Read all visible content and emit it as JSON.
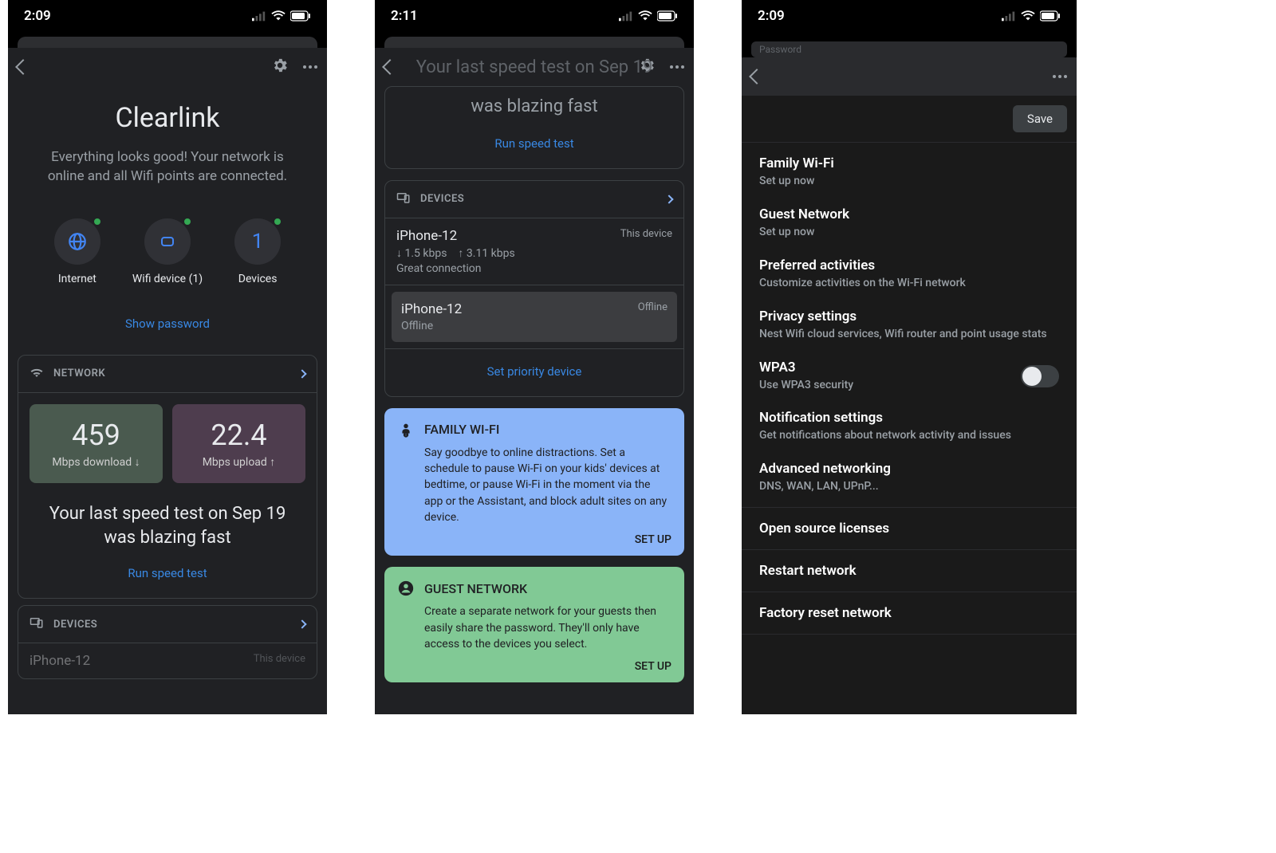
{
  "screen1": {
    "status": {
      "time": "2:09"
    },
    "title": "Clearlink",
    "subtitle": "Everything looks good! Your network is online and all Wifi points are connected.",
    "chips": {
      "internet": "Internet",
      "wifi": "Wifi device (1)",
      "devices_label": "Devices",
      "devices_count": "1"
    },
    "show_password": "Show password",
    "network_header": "NETWORK",
    "download_value": "459",
    "download_label": "Mbps download ↓",
    "upload_value": "22.4",
    "upload_label": "Mbps upload ↑",
    "speed_msg": "Your last speed test on Sep 19 was blazing fast",
    "run_speed_test": "Run speed test",
    "devices_header": "DEVICES",
    "device_peek_name": "iPhone-12",
    "device_peek_tag": "This device"
  },
  "screen2": {
    "status": {
      "time": "2:11"
    },
    "ghost_title": "Your last speed test on Sep 19",
    "speed_msg_tail": "was blazing fast",
    "run_speed_test": "Run speed test",
    "devices_header": "DEVICES",
    "dev1": {
      "name": "iPhone-12",
      "tag": "This device",
      "down": "↓ 1.5 kbps",
      "up": "↑ 3.11 kbps",
      "conn": "Great connection"
    },
    "dev2": {
      "name": "iPhone-12",
      "status": "Offline",
      "tag": "Offline"
    },
    "set_priority": "Set priority device",
    "family": {
      "title": "FAMILY WI-FI",
      "body": "Say goodbye to online distractions. Set a schedule to pause Wi-Fi on your kids' devices at bedtime, or pause Wi-Fi in the moment via the app or the Assistant, and block adult sites on any device.",
      "action": "SET UP"
    },
    "guest": {
      "title": "GUEST NETWORK",
      "body": "Create a separate network for your guests then easily share the password. They'll only have access to the devices you select.",
      "action": "SET UP"
    }
  },
  "screen3": {
    "status": {
      "time": "2:09"
    },
    "pwd_label": "Password",
    "save": "Save",
    "items": [
      {
        "title": "Family Wi-Fi",
        "sub": "Set up now"
      },
      {
        "title": "Guest Network",
        "sub": "Set up now"
      },
      {
        "title": "Preferred activities",
        "sub": "Customize activities on the Wi-Fi network"
      },
      {
        "title": "Privacy settings",
        "sub": "Nest Wifi cloud services, Wifi router and point usage stats"
      },
      {
        "title": "WPA3",
        "sub": "Use WPA3 security",
        "toggle": true
      },
      {
        "title": "Notification settings",
        "sub": "Get notifications about network activity and issues"
      },
      {
        "title": "Advanced networking",
        "sub": "DNS, WAN, LAN, UPnP..."
      },
      {
        "title": "Open source licenses"
      },
      {
        "title": "Restart network"
      },
      {
        "title": "Factory reset network"
      }
    ]
  }
}
